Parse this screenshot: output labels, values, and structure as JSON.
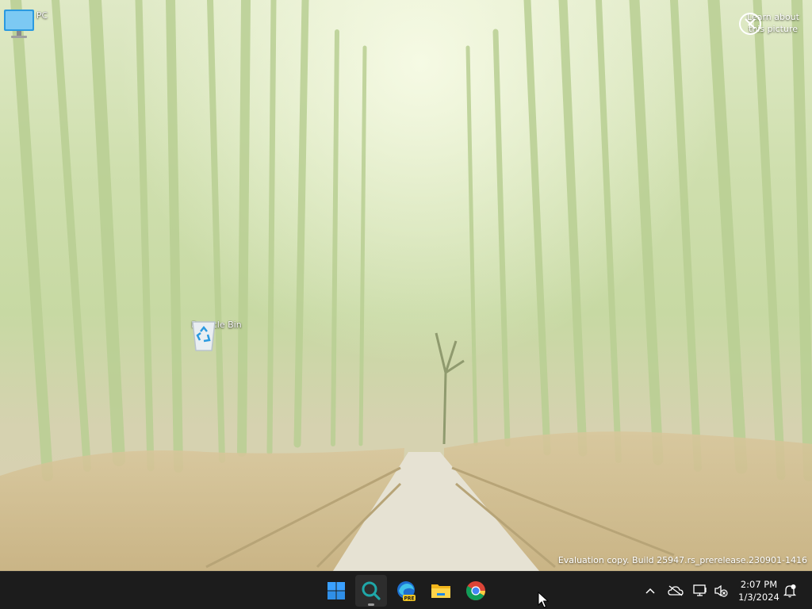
{
  "desktop": {
    "icons": [
      {
        "label": "This PC",
        "icon": "computer-icon"
      },
      {
        "label": "Recycle Bin",
        "icon": "recycle-bin-icon"
      }
    ],
    "learn_about_picture": "Learn about\nthis picture",
    "watermark": "Evaluation copy. Build 25947.rs_prerelease.230901-1416"
  },
  "taskbar": {
    "apps": [
      {
        "name": "Start",
        "icon": "windows-logo-icon"
      },
      {
        "name": "Search",
        "icon": "search-icon"
      },
      {
        "name": "Microsoft Edge Preview",
        "icon": "edge-icon",
        "badge": "PRE"
      },
      {
        "name": "File Explorer",
        "icon": "folder-icon"
      },
      {
        "name": "Google Chrome",
        "icon": "chrome-icon"
      }
    ],
    "tray": {
      "icons": [
        "chevron-up-icon",
        "onedrive-icon",
        "network-icon",
        "volume-muted-icon",
        "notification-icon"
      ],
      "time": "2:07 PM",
      "date": "1/3/2024"
    }
  },
  "colors": {
    "taskbar_bg": "#1c1c1c",
    "windows_blue": "#1e90ff",
    "search_teal": "#1fa7a8"
  }
}
